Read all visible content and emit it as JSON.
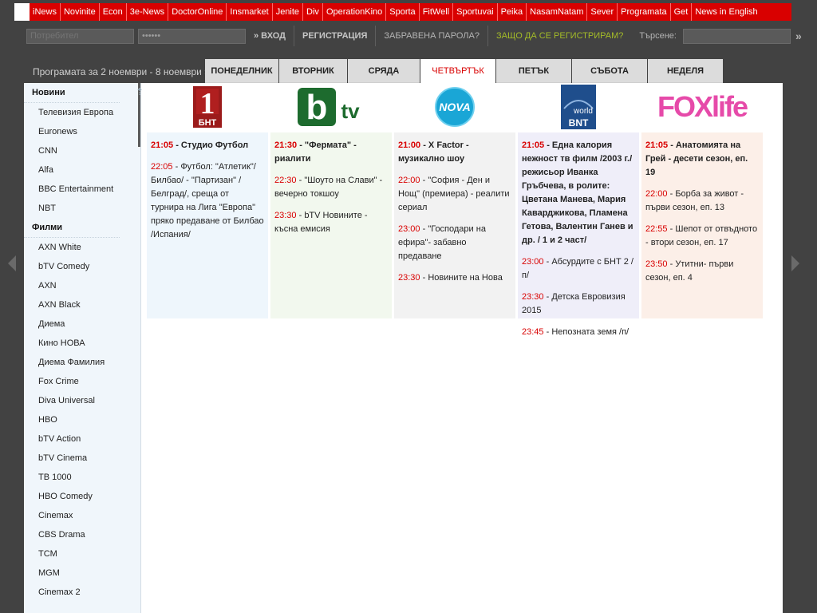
{
  "network_links": [
    "iNews",
    "Novinite",
    "Econ",
    "3e-News",
    "DoctorOnline",
    "Insmarket",
    "Jenite",
    "Div",
    "OperationKino",
    "Sporta",
    "FitWell",
    "Sportuvai",
    "Peika",
    "NasamNatam",
    "Sever",
    "Programata",
    "Get",
    "News in English"
  ],
  "login": {
    "user_placeholder": "Потребител",
    "pass_value": "••••••",
    "login_label": "» ВХОД",
    "register_label": "РЕГИСТРАЦИЯ",
    "forgot_label": "ЗАБРАВЕНА ПАРОЛА?",
    "why_label": "ЗАЩО ДА СЕ РЕГИСТРИРАМ?",
    "search_label": "Търсене:",
    "search_go": "»"
  },
  "schedule": {
    "range": "Програмата за 2 ноември - 8 ноември »",
    "days": [
      "ПОНЕДЕЛНИК",
      "ВТОРНИК",
      "СРЯДА",
      "ЧЕТВЪРТЪК",
      "ПЕТЪК",
      "СЪБОТА",
      "НЕДЕЛЯ"
    ],
    "active_day": "ЧЕТВЪРТЪК"
  },
  "sidebar": {
    "sections": [
      {
        "title": "Новини",
        "items": [
          "Телевизия Европа",
          "Euronews",
          "CNN",
          "Alfa",
          "BBC Entertainment",
          "NBT"
        ]
      },
      {
        "title": "Филми",
        "items": [
          "AXN White",
          "bTV Comedy",
          "AXN",
          "AXN Black",
          "Диема",
          "Кино НОВА",
          "Диема Фамилия",
          "Fox Crime",
          "Diva Universal",
          "HBO",
          "bTV Action",
          "bTV Cinema",
          "TB 1000",
          "HBO Comedy",
          "Cinemax",
          "CBS Drama",
          "TCM",
          "MGM",
          "Cinemax 2"
        ]
      }
    ]
  },
  "channels": [
    {
      "logo_text": "1",
      "logo_sub": "БНТ",
      "bg": "#eef6fc",
      "shows": [
        {
          "time": "21:05",
          "title": "Студио Футбол"
        },
        {
          "time": "22:05",
          "title": "Футбол: \"Атлетик\"/Билбао/ - \"Партизан\" /Белград/, среща от турнира на Лига \"Европа\" пряко предаване от Билбао /Испания/"
        }
      ]
    },
    {
      "logo_text": "btv",
      "logo_sub": "",
      "bg": "#f2f8ee",
      "shows": [
        {
          "time": "21:30",
          "title": "\"Фермата\" - риалити"
        },
        {
          "time": "22:30",
          "title": "\"Шоуто на Слави\" - вечерно токшоу"
        },
        {
          "time": "23:30",
          "title": "bTV Новините - късна емисия"
        }
      ]
    },
    {
      "logo_text": "NOVA",
      "logo_sub": "",
      "bg": "#f2f2f2",
      "shows": [
        {
          "time": "21:00",
          "title": "X Factor - музикално шоу"
        },
        {
          "time": "22:00",
          "title": "\"София - Ден и Нощ\" (премиера) - реалити сериал"
        },
        {
          "time": "23:00",
          "title": "\"Господари на ефира\"- забавно предаване"
        },
        {
          "time": "23:30",
          "title": "Новините на Нова"
        }
      ]
    },
    {
      "logo_text": "world",
      "logo_sub": "BNT",
      "bg": "#efeef9",
      "shows": [
        {
          "time": "21:05",
          "title": "Една калория нежност тв филм /2003 г./ режисьор Иванка Гръбчева, в ролите: Цветана Манева, Мария Каварджикова, Пламена Гетова, Валентин Ганев и др. / 1 и 2 част/"
        },
        {
          "time": "23:00",
          "title": "Абсурдите с БНТ 2 /п/"
        },
        {
          "time": "23:30",
          "title": "Детска Евровизия 2015"
        },
        {
          "time": "23:45",
          "title": "Непозната земя /п/"
        }
      ]
    },
    {
      "logo_text": "FOXlife",
      "logo_sub": "",
      "bg": "#fcefe8",
      "shows": [
        {
          "time": "21:05",
          "title": "Анатомията на Грей - десети сезон, еп. 19"
        },
        {
          "time": "22:00",
          "title": "Борба за живот - първи сезон, еп. 13"
        },
        {
          "time": "22:55",
          "title": "Шепот от отвъдното - втори сезон, еп. 17"
        },
        {
          "time": "23:50",
          "title": "Утитни- първи сезон, еп. 4"
        }
      ]
    }
  ],
  "colors": {
    "accent": "#d90000",
    "active_tab": "#ffffff",
    "tab": "#dcdcdc",
    "green_link": "#a4bc28"
  }
}
